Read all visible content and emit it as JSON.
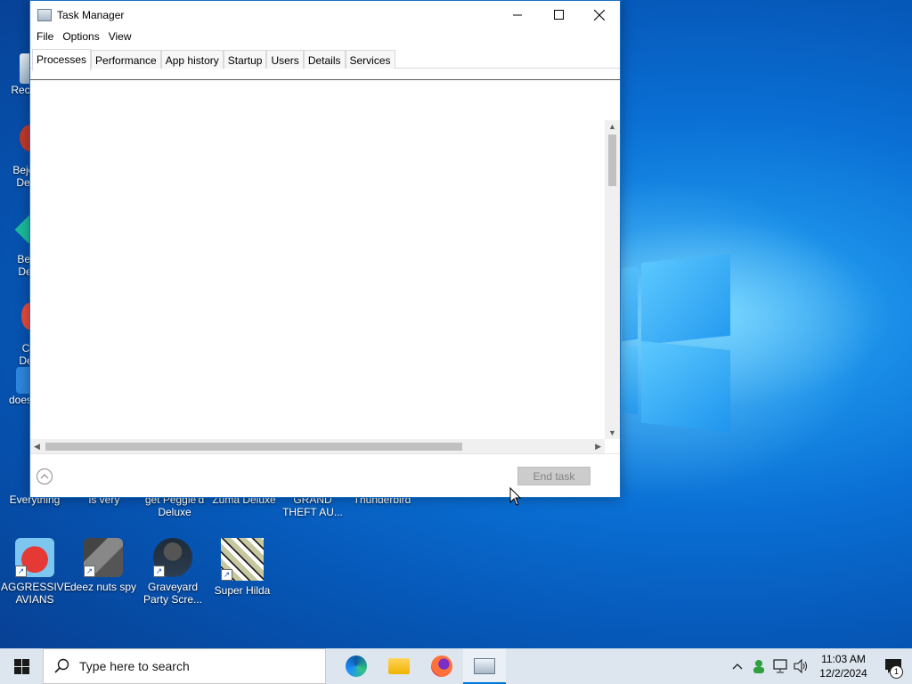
{
  "window": {
    "title": "Task Manager",
    "menu": [
      "File",
      "Options",
      "View"
    ],
    "tabs": [
      "Processes",
      "Performance",
      "App history",
      "Startup",
      "Users",
      "Details",
      "Services"
    ],
    "active_tab": "Processes",
    "end_task_label": "End task"
  },
  "desktop": {
    "partial_left_labels": [
      "Recy",
      "Bejev\nDe",
      "Beje\nDe",
      "Ch\nDe",
      "does"
    ],
    "row_middle": [
      "Everything",
      "is very",
      "get Peggle'd\nDeluxe",
      "Zuma Deluxe",
      "GRAND\nTHEFT AU...",
      "Thunderbird"
    ],
    "row_bottom": [
      "AGGRESSIVE\nAVIANS",
      "deez nuts spy",
      "Graveyard\nParty Scre...",
      "Super Hilda"
    ]
  },
  "taskbar": {
    "search_placeholder": "Type here to search",
    "apps": [
      "edge-icon",
      "file-explorer-icon",
      "firefox-icon",
      "task-manager-icon"
    ],
    "time": "11:03 AM",
    "date": "12/2/2024",
    "notification_count": "1"
  },
  "colors": {
    "accent": "#0078d7",
    "window_border": "#1b6fc4",
    "taskbar_bg": "#dde6ef"
  }
}
